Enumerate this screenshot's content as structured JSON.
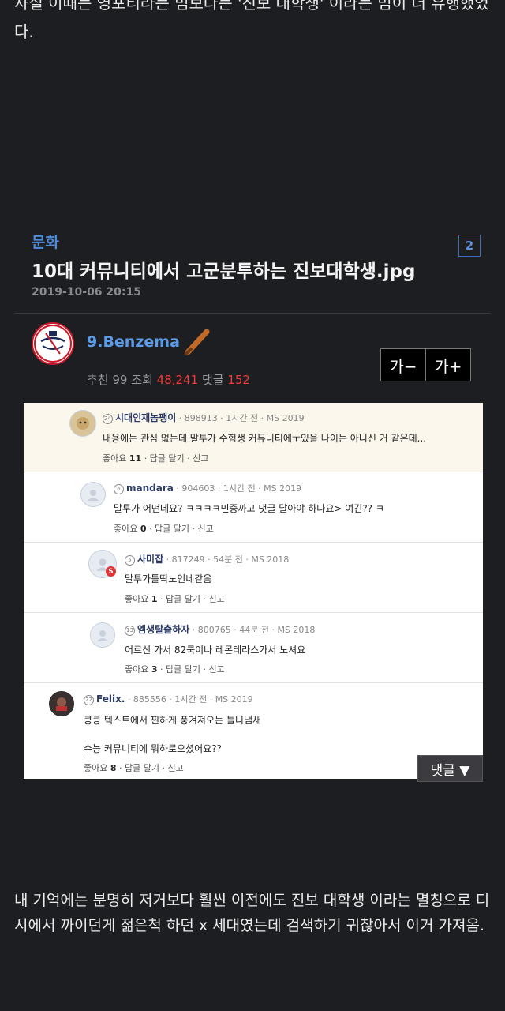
{
  "prev_paragraph": "사실 이때는 영포티라는 밈보다는 '진보 대학생' 이라는 밈이 더 유행했었다.",
  "post": {
    "category": "문화",
    "comment_count_badge": "2",
    "title": "10대 커뮤니티에서 고군분투하는 진보대학생.jpg",
    "date": "2019-10-06 20:15"
  },
  "author": {
    "name": "9.Benzema",
    "stats_recommend_label": "추천",
    "stats_recommend": "99",
    "stats_views_label": "조회",
    "stats_views": "48,241",
    "stats_comments_label": "댓글",
    "stats_comments": "152"
  },
  "font_controls": {
    "decrease": "가−",
    "increase": "가+"
  },
  "comments": [
    {
      "level": "24",
      "nick": "시대인재놈팽이",
      "meta": "· 898913 · 1시간 전 · MS 2019",
      "text": "내용에는 관심 없는데 말투가 수험생 커뮤니티에ㅜ있을 나이는 아니신 거 같은데...",
      "likes_label": "좋아요",
      "likes": "11",
      "actions": "· 답글 달기 · 신고"
    },
    {
      "level": "6",
      "nick": "mandara",
      "meta": "· 904603 · 1시간 전 · MS 2019",
      "text": "말투가 어떤데요? ㅋㅋㅋㅋ민증까고 댓글 달아야 하나요> 여긴?? ㅋ",
      "likes_label": "좋아요",
      "likes": "0",
      "actions": "· 답글 달기 · 신고"
    },
    {
      "level": "5",
      "nick": "사미잡",
      "meta": "· 817249 · 54분 전 · MS 2018",
      "text": "말투가틀딱노인네같음",
      "likes_label": "좋아요",
      "likes": "1",
      "actions": "· 답글 달기 · 신고"
    },
    {
      "level": "13",
      "nick": "엠생탈출하자",
      "meta": "· 800765 · 44분 전 · MS 2018",
      "text": "어르신 가서 82쿡이나 레몬테라스가서 노셔요",
      "likes_label": "좋아요",
      "likes": "3",
      "actions": "· 답글 달기 · 신고"
    },
    {
      "level": "22",
      "nick": "Felix.",
      "meta": "· 885556 · 1시간 전 · MS 2019",
      "text": "킁킁 텍스트에서 찐하게 풍겨져오는 틀니냄새",
      "text2": "수능 커뮤니티에 뭐하로오셨어요??",
      "likes_label": "좋아요",
      "likes": "8",
      "actions": "· 답글 달기 · 신고"
    }
  ],
  "reply_toggle": "댓글 ▼",
  "body_paragraph": "내 기억에는 분명히 저거보다 훨씬 이전에도 진보 대학생 이라는 멸칭으로 디시에서 까이던게 젊은척 하던 x 세대였는데 검색하기 귀찮아서 이거 가져옴.",
  "colors": {
    "background": "#1d1e22",
    "link_blue": "#5c9ce6",
    "accent_red": "#ee3b3b",
    "highlight_comment": "#fcf7ec"
  }
}
